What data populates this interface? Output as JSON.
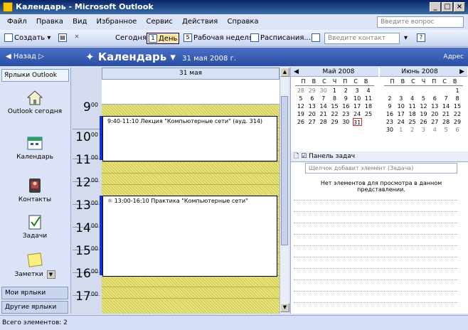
{
  "window": {
    "title": "Календарь - Microsoft Outlook"
  },
  "menu": [
    "Файл",
    "Правка",
    "Вид",
    "Избранное",
    "Сервис",
    "Действия",
    "Справка"
  ],
  "help_placeholder": "Введите вопрос",
  "toolbar": {
    "create": "Создать",
    "today": "Сегодня",
    "day": "День",
    "workweek": "Рабочая неделя",
    "schedules": "Расписания...",
    "contact_placeholder": "Введите контакт"
  },
  "nav": {
    "back": "Назад",
    "title": "Календарь",
    "date": "31 мая 2008 г.",
    "address": "Адрес"
  },
  "left_pane": {
    "header": "Ярлыки Outlook",
    "items": [
      "Outlook сегодня",
      "Календарь",
      "Контакты",
      "Задачи",
      "Заметки"
    ],
    "my_shortcuts": "Мои ярлыки",
    "other_shortcuts": "Другие ярлыки"
  },
  "day": {
    "header": "31 мая",
    "hours": [
      "9",
      "10",
      "11",
      "12",
      "13",
      "14",
      "15",
      "16",
      "17"
    ],
    "minutes": "00",
    "appointments": [
      {
        "text": "9:40-11:10 Лекция \"Компьютерные сети\" (ауд. 314)"
      },
      {
        "text": "13:00-16:10 Практика \"Компьютерные сети\""
      }
    ]
  },
  "mini_calendar": [
    {
      "name": "Май 2008",
      "dow": [
        "П",
        "В",
        "С",
        "Ч",
        "П",
        "С",
        "В"
      ],
      "weeks": [
        [
          "28",
          "29",
          "30",
          "1",
          "2",
          "3",
          "4"
        ],
        [
          "5",
          "6",
          "7",
          "8",
          "9",
          "10",
          "11"
        ],
        [
          "12",
          "13",
          "14",
          "15",
          "16",
          "17",
          "18"
        ],
        [
          "19",
          "20",
          "21",
          "22",
          "23",
          "24",
          "25"
        ],
        [
          "26",
          "27",
          "28",
          "29",
          "30",
          "31",
          ""
        ]
      ]
    },
    {
      "name": "Июнь 2008",
      "dow": [
        "П",
        "В",
        "С",
        "Ч",
        "П",
        "С",
        "В"
      ],
      "weeks": [
        [
          "",
          "",
          "",
          "",
          "",
          "",
          "1"
        ],
        [
          "2",
          "3",
          "4",
          "5",
          "6",
          "7",
          "8"
        ],
        [
          "9",
          "10",
          "11",
          "12",
          "13",
          "14",
          "15"
        ],
        [
          "16",
          "17",
          "18",
          "19",
          "20",
          "21",
          "22"
        ],
        [
          "23",
          "24",
          "25",
          "26",
          "27",
          "28",
          "29"
        ],
        [
          "30",
          "1",
          "2",
          "3",
          "4",
          "5",
          "6"
        ]
      ]
    }
  ],
  "tasks": {
    "header": "Панель задач",
    "input_placeholder": "Щелчок добавит элемент (Задача)",
    "empty": "Нет элементов для просмотра в данном представлении."
  },
  "status": "Всего элементов: 2"
}
